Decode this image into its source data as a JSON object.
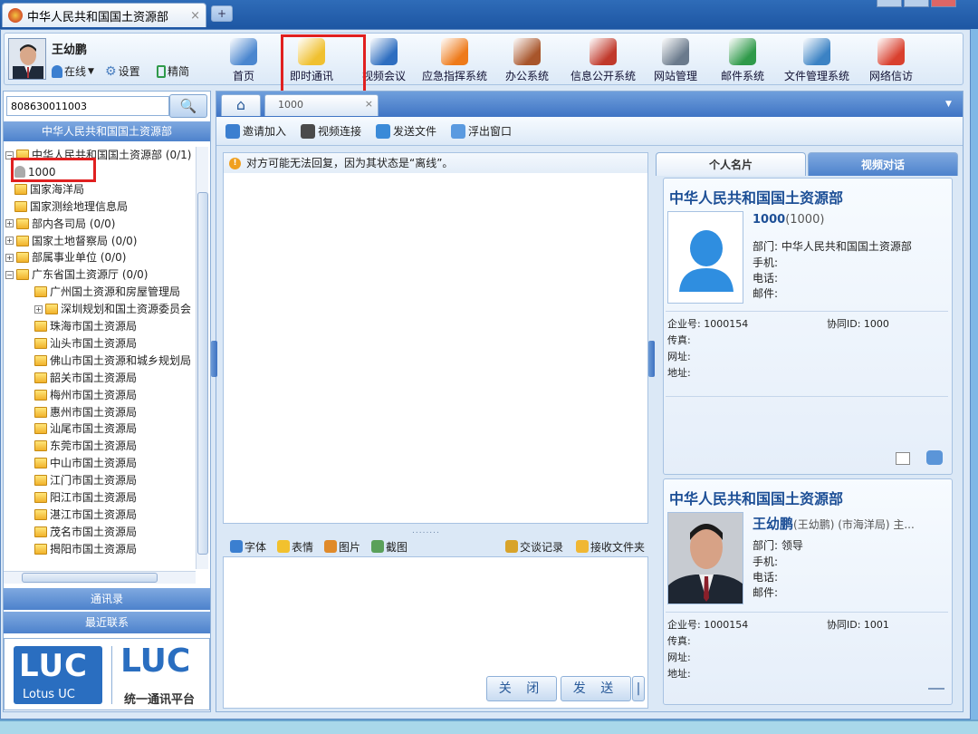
{
  "browser": {
    "tab_title": "中华人民共和国国土资源部",
    "close_glyph": "×",
    "new_tab_glyph": "+"
  },
  "user": {
    "name": "王幼鹏",
    "status": "在线",
    "settings": "设置",
    "language": "精简"
  },
  "toolbar": [
    {
      "label": "首页",
      "icon": "home-icon",
      "color": "#4a86cf"
    },
    {
      "label": "即时通讯",
      "icon": "chat-users-icon",
      "color": "#f0c030"
    },
    {
      "label": "视频会议",
      "icon": "video-meeting-icon",
      "color": "#2e6ec0"
    },
    {
      "label": "应急指挥系统",
      "icon": "traffic-cone-icon",
      "color": "#ee7a1a"
    },
    {
      "label": "办公系统",
      "icon": "office-boxes-icon",
      "color": "#a8552b"
    },
    {
      "label": "信息公开系统",
      "icon": "binders-icon",
      "color": "#c0392b"
    },
    {
      "label": "网站管理",
      "icon": "website-icon",
      "color": "#6a7a8c"
    },
    {
      "label": "邮件系统",
      "icon": "mail-globe-icon",
      "color": "#2f9a4a"
    },
    {
      "label": "文件管理系统",
      "icon": "file-cabinet-icon",
      "color": "#3b82c4"
    },
    {
      "label": "网络信访",
      "icon": "petition-user-icon",
      "color": "#d9402e"
    }
  ],
  "search": {
    "value": "808630011003",
    "button_glyph": "🔍"
  },
  "tree": {
    "header": "中华人民共和国国土资源部",
    "nodes": [
      {
        "label": "中华人民共和国国土资源部 (0/1)",
        "type": "folder",
        "indent": 0,
        "pm": "−"
      },
      {
        "label": "1000",
        "type": "person",
        "indent": 1,
        "pm": ""
      },
      {
        "label": "国家海洋局",
        "type": "folder",
        "indent": 1,
        "pm": ""
      },
      {
        "label": "国家测绘地理信息局",
        "type": "folder",
        "indent": 1,
        "pm": ""
      },
      {
        "label": "部内各司局 (0/0)",
        "type": "folder",
        "indent": 0,
        "pm": "+"
      },
      {
        "label": "国家土地督察局 (0/0)",
        "type": "folder",
        "indent": 0,
        "pm": "+"
      },
      {
        "label": "部属事业单位 (0/0)",
        "type": "folder",
        "indent": 0,
        "pm": "+"
      },
      {
        "label": "广东省国土资源厅 (0/0)",
        "type": "folder",
        "indent": 0,
        "pm": "−"
      },
      {
        "label": "广州国土资源和房屋管理局",
        "type": "folder",
        "indent": 2,
        "pm": ""
      },
      {
        "label": "深圳规划和国土资源委员会",
        "type": "folder",
        "indent": 2,
        "pm": "+"
      },
      {
        "label": "珠海市国土资源局",
        "type": "folder",
        "indent": 2,
        "pm": ""
      },
      {
        "label": "汕头市国土资源局",
        "type": "folder",
        "indent": 2,
        "pm": ""
      },
      {
        "label": "佛山市国土资源和城乡规划局",
        "type": "folder",
        "indent": 2,
        "pm": ""
      },
      {
        "label": "韶关市国土资源局",
        "type": "folder",
        "indent": 2,
        "pm": ""
      },
      {
        "label": "梅州市国土资源局",
        "type": "folder",
        "indent": 2,
        "pm": ""
      },
      {
        "label": "惠州市国土资源局",
        "type": "folder",
        "indent": 2,
        "pm": ""
      },
      {
        "label": "汕尾市国土资源局",
        "type": "folder",
        "indent": 2,
        "pm": ""
      },
      {
        "label": "东莞市国土资源局",
        "type": "folder",
        "indent": 2,
        "pm": ""
      },
      {
        "label": "中山市国土资源局",
        "type": "folder",
        "indent": 2,
        "pm": ""
      },
      {
        "label": "江门市国土资源局",
        "type": "folder",
        "indent": 2,
        "pm": ""
      },
      {
        "label": "阳江市国土资源局",
        "type": "folder",
        "indent": 2,
        "pm": ""
      },
      {
        "label": "湛江市国土资源局",
        "type": "folder",
        "indent": 2,
        "pm": ""
      },
      {
        "label": "茂名市国土资源局",
        "type": "folder",
        "indent": 2,
        "pm": ""
      },
      {
        "label": "揭阳市国土资源局",
        "type": "folder",
        "indent": 2,
        "pm": ""
      }
    ]
  },
  "left_bottom": {
    "contacts": "通讯录",
    "recent": "最近联系"
  },
  "logo": {
    "luc": "LUC",
    "lotus": "Lotus UC",
    "platform": "统一通讯平台"
  },
  "chat": {
    "tab_label": "1000",
    "tab_close": "×",
    "actions": [
      {
        "label": "邀请加入",
        "icon": "invite-icon",
        "color": "#3b7fd0"
      },
      {
        "label": "视频连接",
        "icon": "video-connect-icon",
        "color": "#4a4a4a"
      },
      {
        "label": "发送文件",
        "icon": "send-file-icon",
        "color": "#3a8ad8"
      },
      {
        "label": "浮出窗口",
        "icon": "popout-window-icon",
        "color": "#5a9ae0"
      }
    ],
    "notice": "对方可能无法回复，因为其状态是“离线”。",
    "notice_glyph": "!",
    "splitter_dots": "........",
    "input_tools": [
      {
        "label": "字体",
        "icon": "font-icon",
        "color": "#3b7fd0"
      },
      {
        "label": "表情",
        "icon": "emoji-icon",
        "color": "#f2c12e"
      },
      {
        "label": "图片",
        "icon": "image-icon",
        "color": "#e08a2a"
      },
      {
        "label": "截图",
        "icon": "screenshot-icon",
        "color": "#5aa05a"
      }
    ],
    "input_tools_right": [
      {
        "label": "交谈记录",
        "icon": "history-icon",
        "color": "#d8a32a"
      },
      {
        "label": "接收文件夹",
        "icon": "receive-folder-icon",
        "color": "#f0b733"
      }
    ],
    "close_button": "关 闭",
    "send_button": "发 送",
    "send_dropdown": "|"
  },
  "profile_tabs": {
    "card": "个人名片",
    "video": "视频对话"
  },
  "contact_card": {
    "org": "中华人民共和国国土资源部",
    "name": "1000",
    "name_suffix": "(1000)",
    "department": "部门: 中华人民共和国国土资源部",
    "mobile": "手机:",
    "phone": "电话:",
    "email": "邮件:",
    "enterprise_id": "企业号: 1000154",
    "collab_id": "协同ID: 1000",
    "fax": "传真:",
    "website": "网址:",
    "address": "地址:"
  },
  "self_card": {
    "org": "中华人民共和国国土资源部",
    "name": "王幼鹏",
    "name_suffix": "(王幼鹏) (市海洋局) 主...",
    "department": "部门: 领导",
    "mobile": "手机:",
    "phone": "电话:",
    "email": "邮件:",
    "enterprise_id": "企业号: 1000154",
    "collab_id": "协同ID: 1001",
    "fax": "传真:",
    "website": "网址:",
    "address": "地址:"
  },
  "colors": {
    "accent": "#1d4f96",
    "highlight": "#e02020",
    "header_blue": "#4d82cc"
  }
}
